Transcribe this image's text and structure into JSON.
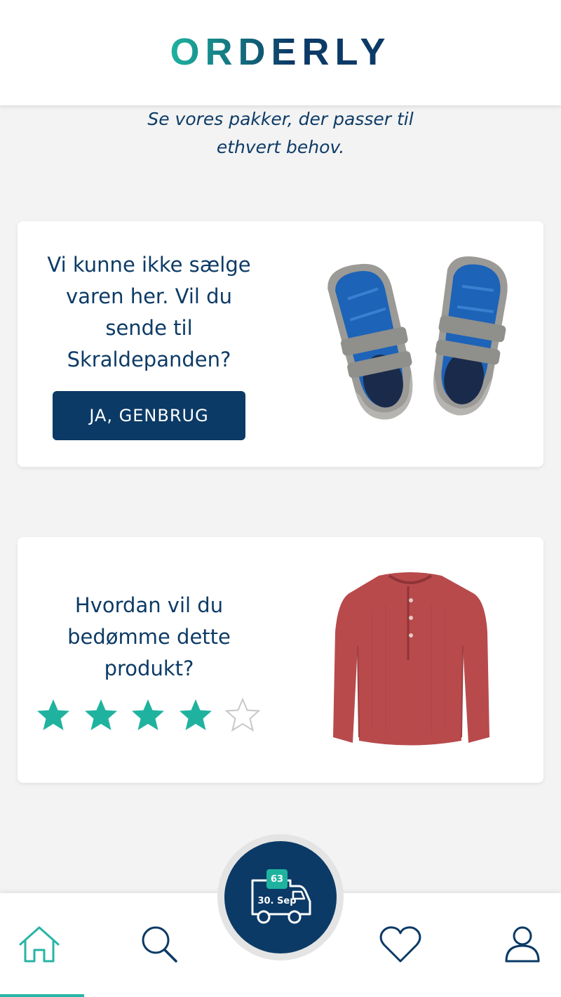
{
  "brand": {
    "name": "ORDERLY",
    "gradient_start": "#1fb39f",
    "gradient_end": "#0b3a66"
  },
  "tagline": {
    "line1": "Se vores pakker, der passer til",
    "line2": "ethvert behov."
  },
  "cards": [
    {
      "line1": "Vi kunne ikke sælge",
      "line2": "varen her. Vil du",
      "line3": "sende til",
      "line4": "Skraldepanden?",
      "button_label": "JA, GENBRUG",
      "image": "blue-grey-velcro-sneakers"
    },
    {
      "line1": "Hvordan vil du",
      "line2": "bedømme dette",
      "line3": "produkt?",
      "rating": 4,
      "rating_max": 5,
      "image": "red-long-sleeve-shirt"
    }
  ],
  "fab": {
    "badge": "63",
    "date": "30. Sep",
    "icon": "delivery-truck-icon"
  },
  "nav": {
    "items": [
      "home-icon",
      "search-icon",
      "heart-icon",
      "user-icon"
    ],
    "active": "home",
    "accent_color": "#27b5a6",
    "primary_color": "#0b3a66"
  }
}
